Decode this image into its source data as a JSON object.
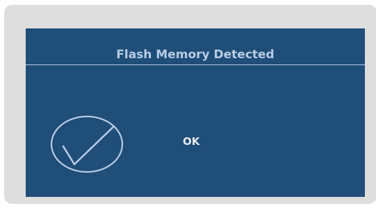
{
  "dialog": {
    "title": "Flash Memory Detected",
    "confirm_label": "OK",
    "status_icon": "checkmark-icon"
  },
  "colors": {
    "frame": "#dedede",
    "panel": "#1f4e79",
    "title_text": "#b8cce4",
    "icon_stroke": "#b8cce4",
    "button_text": "#e6ecf4"
  }
}
